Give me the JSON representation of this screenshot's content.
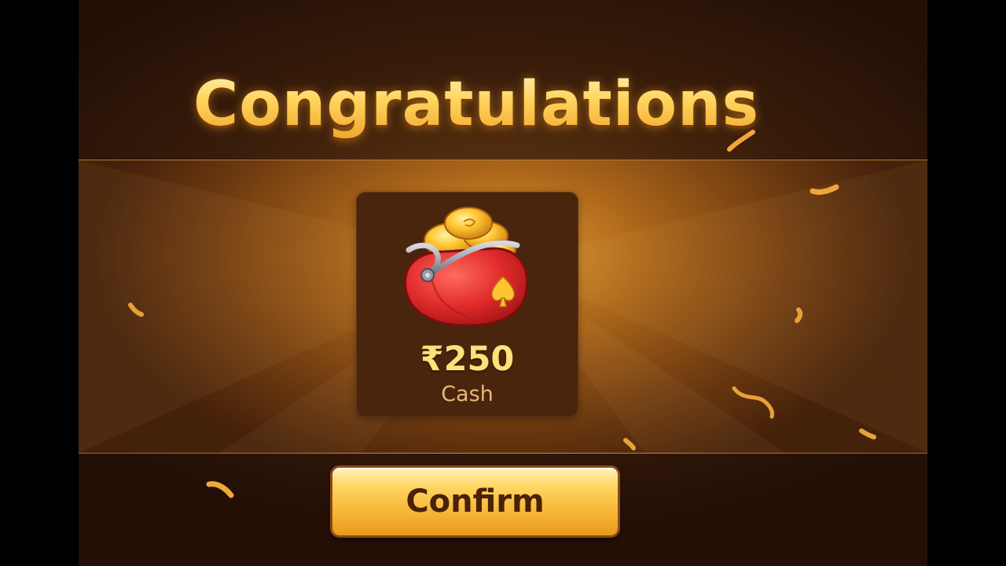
{
  "dialog": {
    "title": "Congratulations",
    "reward": {
      "amount": "₹250",
      "unit": "Cash",
      "icon": "coin-purse-icon"
    },
    "confirm_label": "Confirm"
  },
  "colors": {
    "title_gold": "#ffd36a",
    "band_orange": "#e8a034",
    "card_brown": "#4a250d",
    "button_gold": "#f5b232",
    "button_text": "#4a2108",
    "purse_red": "#e02a2a"
  }
}
